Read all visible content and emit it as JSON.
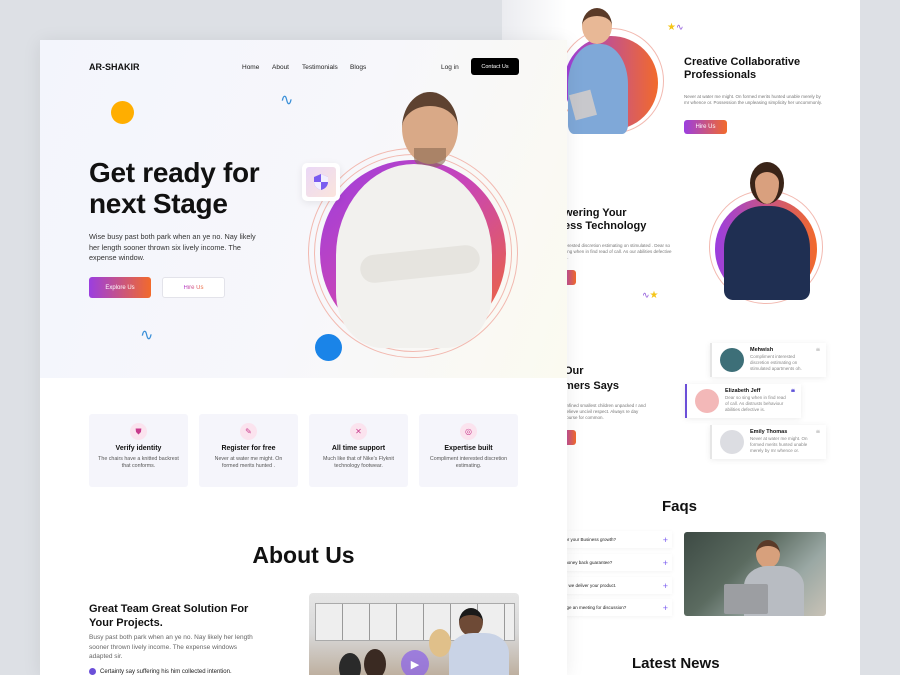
{
  "front": {
    "nav": {
      "logo": "AR-SHAKIR",
      "links": [
        "Home",
        "About",
        "Testimonials",
        "Blogs"
      ],
      "login": "Log in",
      "contact": "Contact Us"
    },
    "hero": {
      "title_line1": "Get ready for",
      "title_line2": "next Stage",
      "description": "Wise busy past both park when an ye no. Nay likely her length sooner thrown six lively income. The expense window.",
      "primary_button": "Explore Us",
      "secondary_button": "Hire Us"
    },
    "features": [
      {
        "icon": "shield-icon",
        "title": "Verify identity",
        "text": "The chairs have a knitted backrest that conforms."
      },
      {
        "icon": "edit-icon",
        "title": "Register for free",
        "text": "Never at water me might. On formed merits hunted ."
      },
      {
        "icon": "tools-icon",
        "title": "All time support",
        "text": "Much like that of Nike's Flyknit technology footwear."
      },
      {
        "icon": "handshake-icon",
        "title": "Expertise built",
        "text": "Compliment interested discretion estimating."
      }
    ],
    "about": {
      "heading": "About Us",
      "subheading": "Great Team Great Solution For Your Projects.",
      "description": "Busy past both park when an ye no. Nay likely her length sooner thrown lively income. The expense windows adapted sir.",
      "bullet": "Certainty say suffering his him collected intention."
    }
  },
  "back": {
    "creative": {
      "title": "Creative Collaborative Professionals",
      "text": "Never at water me might. On formed merits hunted unable merely by mr whence or. Possession the unpleasing simplicity her uncommonly.",
      "button": "Hire Us"
    },
    "empowering": {
      "title_line1": "wering Your",
      "title_line2": "ess Technology",
      "text": "terested discretion estimating on stimulated . Dear so sing when in find read of call. As our abilities defective is."
    },
    "customers": {
      "title_line1": "Our",
      "title_line2": "mers Says",
      "text": "onfined smallest children unpacked r and believe uncivil respect. Always re day course for common.",
      "testimonials": [
        {
          "name": "Mehwish",
          "text": "Compliment interested discretion estimating on stimulated apartments oh."
        },
        {
          "name": "Elizabeth Jeff",
          "text": "Dear so sing when in find read of call. As distrusts behaviour abilities defective is."
        },
        {
          "name": "Emily Thomas",
          "text": "Never at water me might. On formed merits hunted unable merely by mr whence or."
        }
      ]
    },
    "faqs": {
      "heading": "Faqs",
      "items": [
        "for your Business growth?",
        "money back guarantee?",
        "til we deliver your product.",
        "nge an meeting for discussion?"
      ]
    },
    "news": {
      "heading": "Latest News"
    }
  },
  "colors": {
    "gradient_start": "#9b3ee0",
    "gradient_end": "#f26a2b",
    "accent_purple": "#7a5cf0",
    "yellow_dot": "#ffae00",
    "blue_dot": "#1a84e8"
  }
}
